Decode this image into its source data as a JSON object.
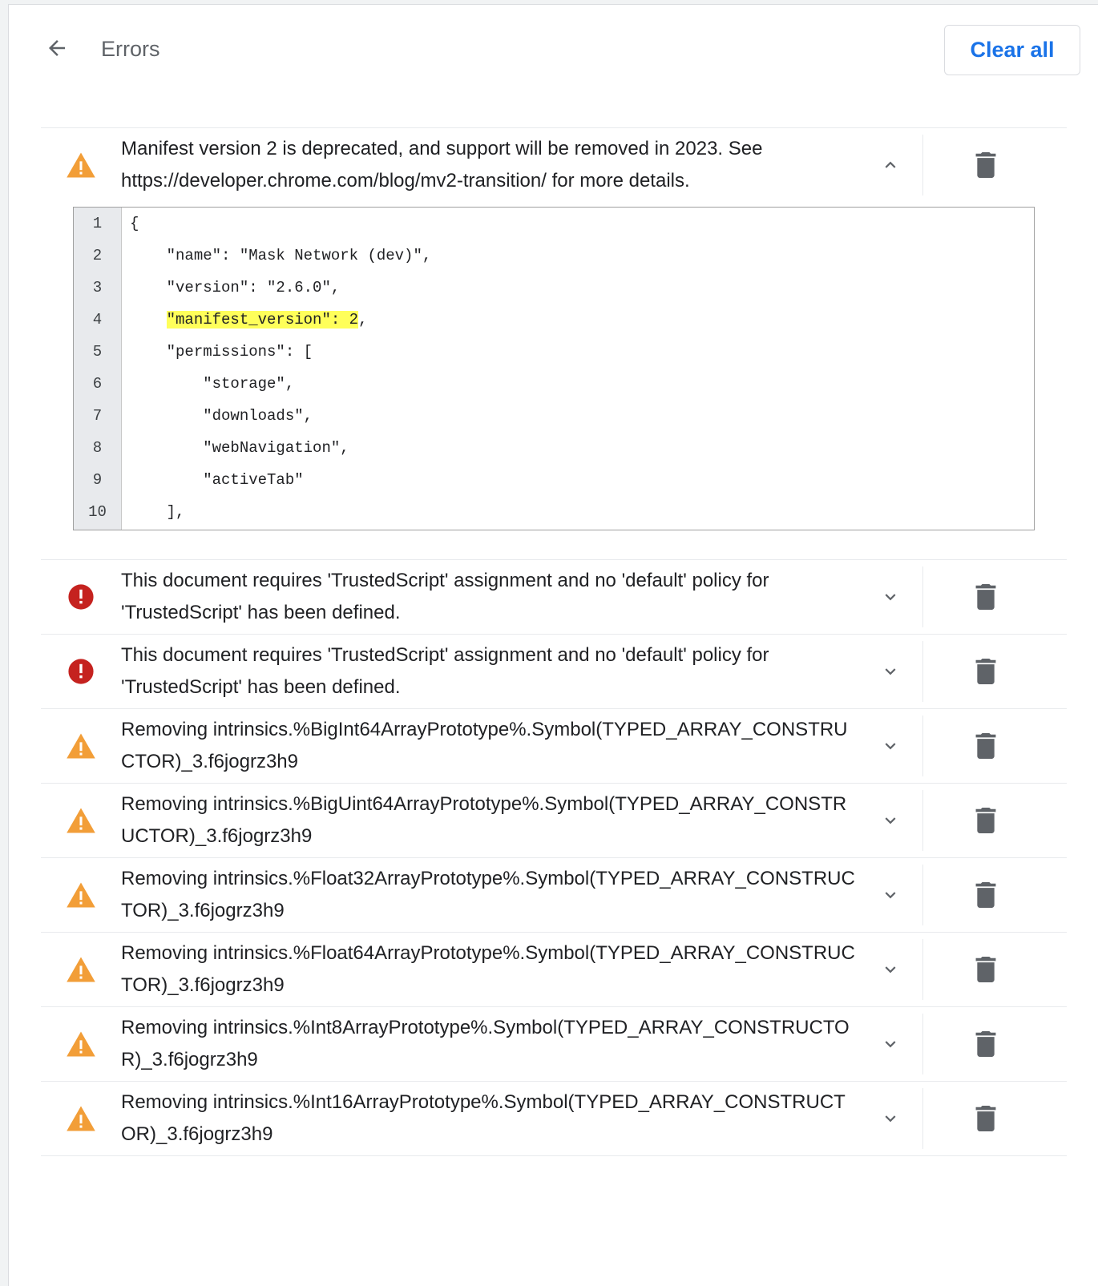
{
  "header": {
    "title": "Errors",
    "clear_all_label": "Clear all"
  },
  "colors": {
    "accent": "#1a73e8",
    "warning": "#f29e38",
    "error": "#c5221f",
    "highlight": "#ffff5a"
  },
  "icons": {
    "back": "arrow-left-icon",
    "warning": "warning-triangle-icon",
    "error": "error-circle-icon",
    "expand": "chevron-down-icon",
    "collapse": "chevron-up-icon",
    "delete": "trash-icon"
  },
  "errors": [
    {
      "severity": "warning",
      "expanded": true,
      "message": "Manifest version 2 is deprecated, and support will be removed in 2023. See https://developer.chrome.com/blog/mv2-transition/ for more details.",
      "code": {
        "line_numbers": [
          "1",
          "2",
          "3",
          "4",
          "5",
          "6",
          "7",
          "8",
          "9",
          "10"
        ],
        "lines": [
          {
            "indent": "",
            "pre": "{",
            "hl": "",
            "post": ""
          },
          {
            "indent": "    ",
            "pre": "\"name\": \"Mask Network (dev)\",",
            "hl": "",
            "post": ""
          },
          {
            "indent": "    ",
            "pre": "\"version\": \"2.6.0\",",
            "hl": "",
            "post": ""
          },
          {
            "indent": "    ",
            "pre": "",
            "hl": "\"manifest_version\": 2",
            "post": ","
          },
          {
            "indent": "    ",
            "pre": "\"permissions\": [",
            "hl": "",
            "post": ""
          },
          {
            "indent": "        ",
            "pre": "\"storage\",",
            "hl": "",
            "post": ""
          },
          {
            "indent": "        ",
            "pre": "\"downloads\",",
            "hl": "",
            "post": ""
          },
          {
            "indent": "        ",
            "pre": "\"webNavigation\",",
            "hl": "",
            "post": ""
          },
          {
            "indent": "        ",
            "pre": "\"activeTab\"",
            "hl": "",
            "post": ""
          },
          {
            "indent": "    ",
            "pre": "],",
            "hl": "",
            "post": ""
          }
        ]
      }
    },
    {
      "severity": "error",
      "expanded": false,
      "message": "This document requires 'TrustedScript' assignment and no 'default' policy for 'TrustedScript' has been defined."
    },
    {
      "severity": "error",
      "expanded": false,
      "message": "This document requires 'TrustedScript' assignment and no 'default' policy for 'TrustedScript' has been defined."
    },
    {
      "severity": "warning",
      "expanded": false,
      "message": "Removing intrinsics.%BigInt64ArrayPrototype%.Symbol(TYPED_ARRAY_CONSTRUCTOR)_3.f6jogrz3h9"
    },
    {
      "severity": "warning",
      "expanded": false,
      "message": "Removing intrinsics.%BigUint64ArrayPrototype%.Symbol(TYPED_ARRAY_CONSTRUCTOR)_3.f6jogrz3h9"
    },
    {
      "severity": "warning",
      "expanded": false,
      "message": "Removing intrinsics.%Float32ArrayPrototype%.Symbol(TYPED_ARRAY_CONSTRUCTOR)_3.f6jogrz3h9"
    },
    {
      "severity": "warning",
      "expanded": false,
      "message": "Removing intrinsics.%Float64ArrayPrototype%.Symbol(TYPED_ARRAY_CONSTRUCTOR)_3.f6jogrz3h9"
    },
    {
      "severity": "warning",
      "expanded": false,
      "message": "Removing intrinsics.%Int8ArrayPrototype%.Symbol(TYPED_ARRAY_CONSTRUCTOR)_3.f6jogrz3h9"
    },
    {
      "severity": "warning",
      "expanded": false,
      "message": "Removing intrinsics.%Int16ArrayPrototype%.Symbol(TYPED_ARRAY_CONSTRUCTOR)_3.f6jogrz3h9"
    }
  ]
}
